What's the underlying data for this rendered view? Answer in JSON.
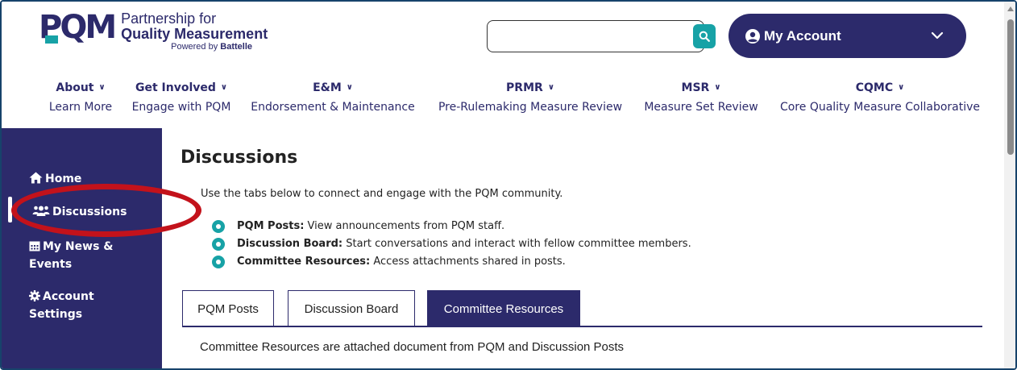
{
  "logo": {
    "mark": "PQM",
    "line1": "Partnership for",
    "line2": "Quality Measurement",
    "line3_prefix": "Powered by ",
    "line3_brand": "Battelle"
  },
  "search": {
    "value": "",
    "placeholder": ""
  },
  "account": {
    "label": "My Account"
  },
  "nav": [
    {
      "label": "About",
      "sub": "Learn More"
    },
    {
      "label": "Get Involved",
      "sub": "Engage with PQM"
    },
    {
      "label": "E&M",
      "sub": "Endorsement & Maintenance"
    },
    {
      "label": "PRMR",
      "sub": "Pre-Rulemaking Measure Review"
    },
    {
      "label": "MSR",
      "sub": "Measure Set Review"
    },
    {
      "label": "CQMC",
      "sub": "Core Quality Measure Collaborative"
    }
  ],
  "sidebar": {
    "items": [
      {
        "label": "Home",
        "icon": "home-icon"
      },
      {
        "label": "Discussions",
        "icon": "users-icon",
        "active": true
      },
      {
        "label_line1": "My News &",
        "label_line2": "Events",
        "icon": "calendar-icon"
      },
      {
        "label_line1": "Account",
        "label_line2": "Settings",
        "icon": "gear-icon"
      }
    ]
  },
  "main": {
    "title": "Discussions",
    "intro": "Use the tabs below to connect and engage with the PQM community.",
    "bullets": [
      {
        "term": "PQM Posts:",
        "text": " View announcements from PQM staff."
      },
      {
        "term": "Discussion Board:",
        "text": " Start conversations and interact with fellow committee members."
      },
      {
        "term": "Committee Resources:",
        "text": " Access attachments shared in posts."
      }
    ],
    "tabs": [
      {
        "label": "PQM Posts"
      },
      {
        "label": "Discussion Board"
      },
      {
        "label": "Committee Resources",
        "active": true
      }
    ],
    "tab_content": "Committee Resources are attached document from PQM and Discussion Posts"
  },
  "colors": {
    "brand_navy": "#2c2a6b",
    "accent_teal": "#17a2a6",
    "highlight_red": "#c3121b"
  }
}
